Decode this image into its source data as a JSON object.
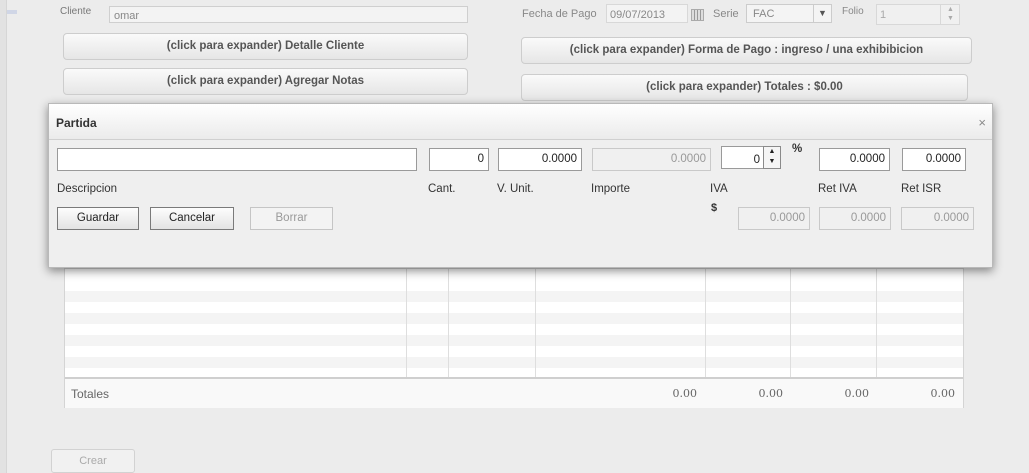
{
  "header": {
    "cliente_label": "Cliente",
    "cliente_value": "omar",
    "fecha_label": "Fecha de Pago",
    "fecha_value": "09/07/2013",
    "serie_label": "Serie",
    "serie_value": "FAC",
    "folio_label": "Folio",
    "folio_value": "1"
  },
  "sections": {
    "detalle_cliente": "(click para expander) Detalle Cliente",
    "forma_pago": "(click para expander) Forma de Pago : ingreso / una exhibibicion",
    "agregar_notas": "(click para expander) Agregar Notas",
    "totales": "(click para expander) Totales : $0.00"
  },
  "dialog": {
    "title": "Partida",
    "close": "×",
    "fields": {
      "descripcion": "",
      "cant": "0",
      "v_unit": "0.0000",
      "importe": "0.0000",
      "iva_pct": "0",
      "ret_iva": "0.0000",
      "ret_isr": "0.0000",
      "iva_amount": "0.0000",
      "ret_iva_amount": "0.0000",
      "ret_isr_amount": "0.0000"
    },
    "labels": {
      "descripcion": "Descripcion",
      "cant": "Cant.",
      "v_unit": "V. Unit.",
      "importe": "Importe",
      "iva": "IVA",
      "ret_iva": "Ret IVA",
      "ret_isr": "Ret ISR",
      "percent": "%",
      "dollar": "$"
    },
    "buttons": {
      "guardar": "Guardar",
      "cancelar": "Cancelar",
      "borrar": "Borrar"
    }
  },
  "table": {
    "totales_label": "Totales",
    "totals": [
      "0.00",
      "0.00",
      "0.00",
      "0.00"
    ]
  },
  "footer": {
    "crear": "Crear"
  }
}
